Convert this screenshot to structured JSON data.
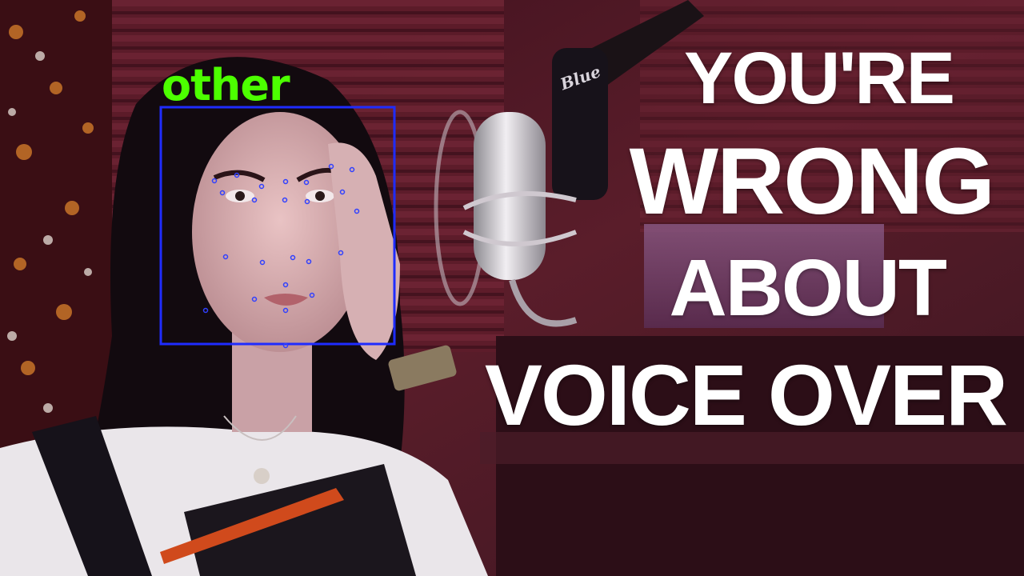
{
  "thumbnail": {
    "title_lines": [
      "YOU'RE",
      "WRONG",
      "ABOUT",
      "VOICE OVER"
    ]
  },
  "detection": {
    "label": "other",
    "box_color": "#1f2cff",
    "label_color": "#4cff00",
    "landmark_color": "#3040ff"
  },
  "scene": {
    "mic_brand": "Blue",
    "background_color": "#5a1d2a"
  }
}
